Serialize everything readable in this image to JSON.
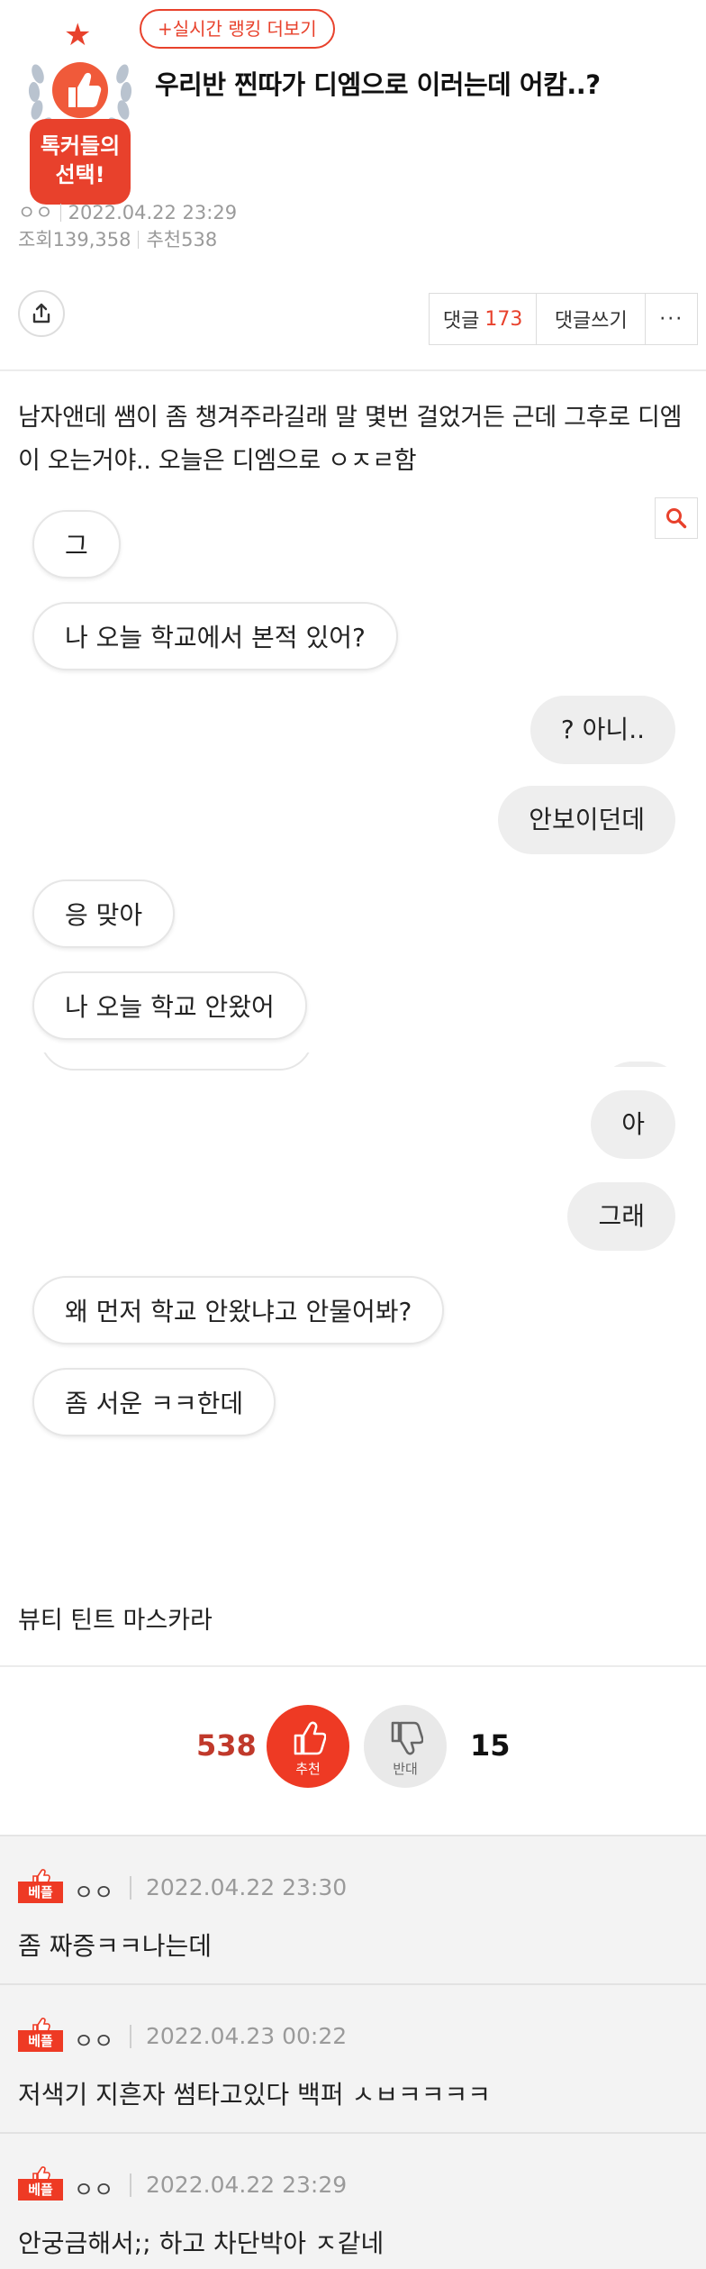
{
  "header": {
    "ranking_link": "+실시간 랭킹 더보기",
    "badge_text": "톡커들의\n선택!",
    "title": "우리반 찐따가 디엠으로 이러는데 어캄..?",
    "author": "ㅇㅇ",
    "date": "2022.04.22 23:29",
    "views_label": "조회",
    "views": "139,358",
    "likes_label": "추천",
    "likes": "538"
  },
  "actions": {
    "comments_label": "댓글",
    "comments_count": "173",
    "write_comment": "댓글쓰기",
    "more": "···"
  },
  "post": {
    "intro": "남자앤데 쌤이 좀 챙겨주라길래 말 몇번 걸었거든 근데 그후로 디엠이 오는거야.. 오늘은 디엠으로 ㅇㅈㄹ함",
    "messages": [
      {
        "side": "left",
        "text": "그"
      },
      {
        "side": "left",
        "text": "나 오늘 학교에서 본적 있어?"
      },
      {
        "side": "right",
        "text": "? 아니.."
      },
      {
        "side": "right",
        "text": "안보이던데"
      },
      {
        "side": "left",
        "text": "응 맞아"
      },
      {
        "side": "left",
        "text": "나 오늘 학교 안왔어"
      },
      {
        "side": "right",
        "text": "아"
      },
      {
        "side": "right",
        "text": "그래"
      },
      {
        "side": "left",
        "text": "왜 먼저 학교 안왔냐고 안물어봐?"
      },
      {
        "side": "left",
        "text": "좀 서운 ㅋㅋ한데"
      }
    ],
    "product": "뷰티 틴트 마스카라"
  },
  "vote": {
    "up_count": "538",
    "up_label": "추천",
    "down_label": "반대",
    "down_count": "15"
  },
  "comments": [
    {
      "badge": "베플",
      "author": "ㅇㅇ",
      "date": "2022.04.22 23:30",
      "text": "좀 짜증ㅋㅋ나는데"
    },
    {
      "badge": "베플",
      "author": "ㅇㅇ",
      "date": "2022.04.23 00:22",
      "text": "저색기 지흔자 썸타고있다 백퍼 ㅅㅂㅋㅋㅋㅋ"
    },
    {
      "badge": "베플",
      "author": "ㅇㅇ",
      "date": "2022.04.22 23:29",
      "text": "안궁금해서;; 하고 차단박아 ㅈ같네"
    }
  ],
  "colors": {
    "accent": "#e8412c",
    "bubble_right": "#eeeeee",
    "comment_bg": "#f3f3f3"
  }
}
